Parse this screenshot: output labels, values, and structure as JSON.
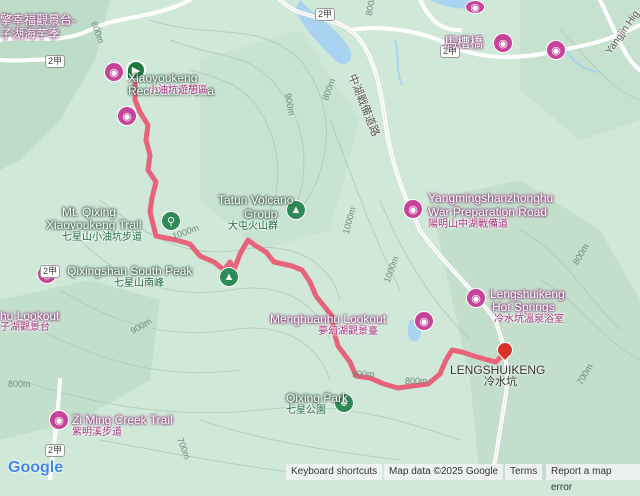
{
  "map": {
    "poi": {
      "xiaoyoukeng_en": "Xiaoyoukeng Recreation Area",
      "xiaoyoukeng_zh": "小油坑遊憩區",
      "tatun_en_1": "Tatun Volcano",
      "tatun_en_2": "Group",
      "tatun_zh": "大屯火山群",
      "qixing_trail_en_1": "Mt. Qixing",
      "qixing_trail_en_2": "Xiaoyoukeng Trail",
      "qixing_trail_zh": "七星山小油坑步道",
      "south_peak_en": "Qixingshan South Peak",
      "south_peak_zh": "七星山南峰",
      "menghuanhu_en": "Menghuanhu Lookout",
      "menghuanhu_zh": "夢幻湖觀景臺",
      "qixing_park_en": "Qixing Park",
      "qixing_park_zh": "七星公園",
      "lengshuikeng_en": "LENGSHUIKENG",
      "lengshuikeng_zh": "冷水坑",
      "hotsprings_en_1": "Lengshuikeng",
      "hotsprings_en_2": "Hot Springs",
      "hotsprings_zh": "冷水坑溫泉浴室",
      "yangming_en_1": "Yangmingshanzhonghu",
      "yangming_en_2": "War Preparation Road",
      "yangming_zh": "陽明山中湖戰備道",
      "macaoqiao": "馬槽橋",
      "ziming_en": "Zi Ming Creek Trail",
      "ziming_zh": "紫明溪步道",
      "hu_lookout_en": "hu Lookout",
      "hu_lookout_zh": "子湖觀景台",
      "topleft_1": "擎幸福觀景台-",
      "topleft_2": "子湖海芋季",
      "yangjin_road": "Yangjin Hig",
      "zhonghu_road": "中湖戰備道路"
    },
    "shields": [
      "2甲",
      "2甲",
      "2甲",
      "2甲",
      "2甲"
    ],
    "contours": [
      "800m",
      "1000m",
      "1000m",
      "900m",
      "800m",
      "900m",
      "800m",
      "900m",
      "800m",
      "700m",
      "700m",
      "800m",
      "1000m",
      "800m"
    ],
    "colors": {
      "terrain": "#cfe8d8",
      "route": "#e8627a",
      "poi_pink": "#c7439a",
      "poi_green": "#2e8b57",
      "road": "#ffffff",
      "water": "#a9d3f0"
    },
    "icons": {
      "start": "green-flag-icon",
      "end": "red-pin-icon",
      "attraction": "camera-icon",
      "park": "tree-icon",
      "hiking": "hiker-icon"
    }
  },
  "footer": {
    "logo": "Google",
    "shortcuts": "Keyboard shortcuts",
    "map_data": "Map data ©2025 Google",
    "terms": "Terms",
    "report": "Report a map error"
  }
}
